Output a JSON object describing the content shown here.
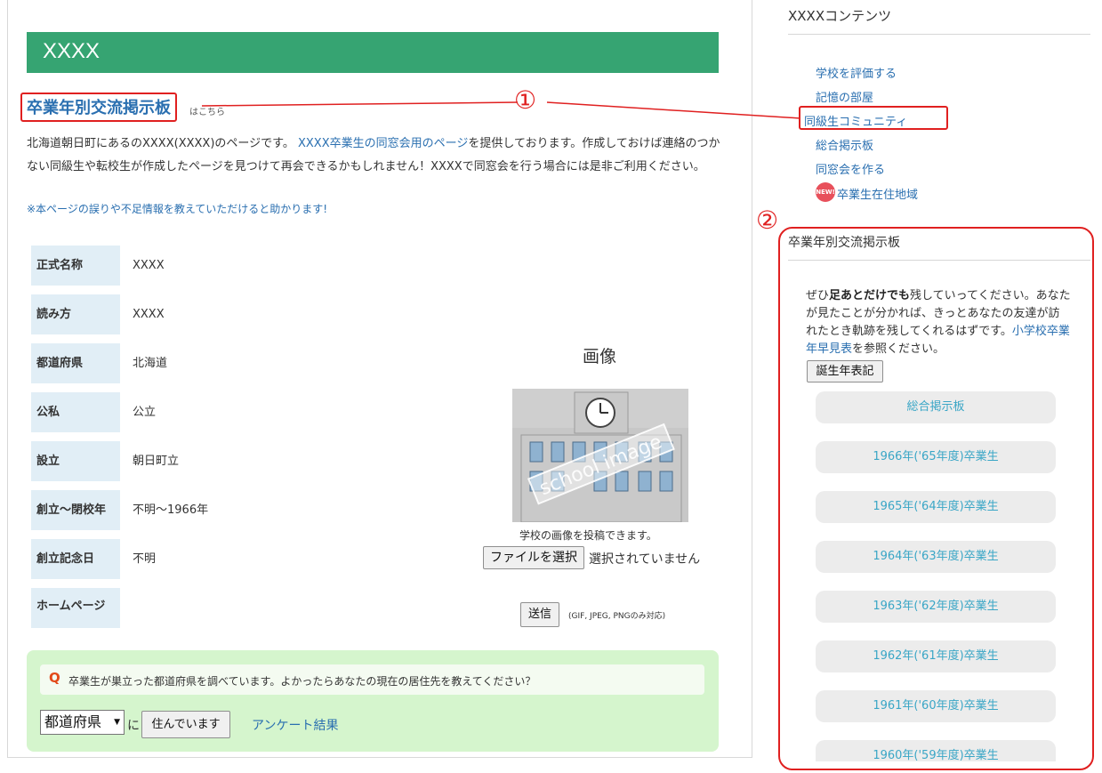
{
  "banner": {
    "title": "XXXX"
  },
  "board_link": {
    "label": "卒業年別交流掲示板",
    "suffix": "はこちら"
  },
  "intro": {
    "text_before": "北海道朝日町にあるのXXXX(XXXX)のページです。",
    "link": "XXXX卒業生の同窓会用のページ",
    "text_after": "を提供しております。作成しておけば連絡のつかない同級生や転校生が作成したページを見つけて再会できるかもしれません！XXXXで同窓会を行う場合には是非ご利用ください。",
    "note": "※本ページの誤りや不足情報を教えていただけると助かります!"
  },
  "info_table": [
    {
      "label": "正式名称",
      "value": "XXXX"
    },
    {
      "label": "読み方",
      "value": "XXXX"
    },
    {
      "label": "都道府県",
      "value": "北海道"
    },
    {
      "label": "公私",
      "value": "公立"
    },
    {
      "label": "設立",
      "value": "朝日町立"
    },
    {
      "label": "創立〜閉校年",
      "value": "不明〜1966年"
    },
    {
      "label": "創立記念日",
      "value": "不明"
    },
    {
      "label": "ホームページ",
      "value": ""
    }
  ],
  "image_block": {
    "title": "画像",
    "watermark": "school image",
    "caption": "学校の画像を投稿できます。",
    "file_button": "ファイルを選択",
    "file_status": "選択されていません",
    "send_button": "送信",
    "formats": "(GIF, JPEG, PNGのみ対応)"
  },
  "survey": {
    "q_mark": "Q",
    "question": "卒業生が巣立った都道府県を調べています。よかったらあなたの現在の居住先を教えてください？",
    "select_value": "都道府県",
    "particle": "に",
    "live_button": "住んでいます",
    "result_link": "アンケート結果"
  },
  "sidebar": {
    "title": "XXXXコンテンツ",
    "links": [
      "学校を評価する",
      "記憶の部屋",
      "同級生コミュニティ",
      "総合掲示板",
      "同窓会を作る"
    ],
    "new_badge": "NEW!",
    "area_link": "卒業生在住地域"
  },
  "board": {
    "title": "卒業年別交流掲示板",
    "desc_1": "ぜひ",
    "desc_bold": "足あとだけでも",
    "desc_2": "残していってください。あなたが見たことが分かれば、きっとあなたの友達が訪れたとき軌跡を残してくれるはずです。",
    "early_link": "小学校卒業年早見表",
    "desc_3": "を参照ください。",
    "birth_button": "誕生年表記",
    "general_board": "総合掲示板",
    "years": [
      "1966年('65年度)卒業生",
      "1965年('64年度)卒業生",
      "1964年('63年度)卒業生",
      "1963年('62年度)卒業生",
      "1962年('61年度)卒業生",
      "1961年('60年度)卒業生",
      "1960年('59年度)卒業生"
    ]
  },
  "annotations": {
    "one": "①",
    "two": "②"
  },
  "colors": {
    "banner": "#36a472",
    "link": "#2a6fb0",
    "highlight": "#e02020",
    "year_text": "#3aa6c6"
  }
}
